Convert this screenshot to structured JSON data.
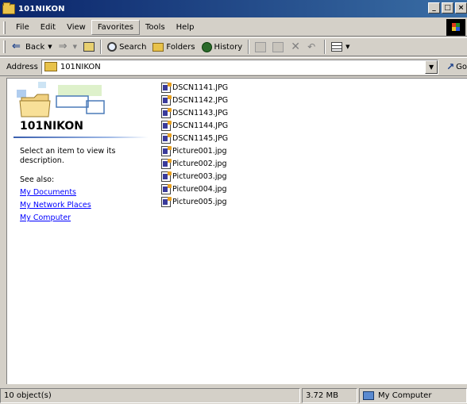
{
  "window": {
    "title": "101NIKON"
  },
  "menu": {
    "items": [
      "File",
      "Edit",
      "View",
      "Favorites",
      "Tools",
      "Help"
    ]
  },
  "toolbar": {
    "back_label": "Back",
    "search_label": "Search",
    "folders_label": "Folders",
    "history_label": "History"
  },
  "address": {
    "label": "Address",
    "value": "101NIKON",
    "go_label": "Go"
  },
  "webview": {
    "folder_name": "101NIKON",
    "description": "Select an item to view its description.",
    "see_also": "See also:",
    "links": [
      "My Documents",
      "My Network Places",
      "My Computer"
    ]
  },
  "files": [
    "DSCN1141.JPG",
    "DSCN1142.JPG",
    "DSCN1143.JPG",
    "DSCN1144.JPG",
    "DSCN1145.JPG",
    "Picture001.jpg",
    "Picture002.jpg",
    "Picture003.jpg",
    "Picture004.jpg",
    "Picture005.jpg"
  ],
  "status": {
    "count": "10 object(s)",
    "size": "3.72 MB",
    "zone": "My Computer"
  }
}
